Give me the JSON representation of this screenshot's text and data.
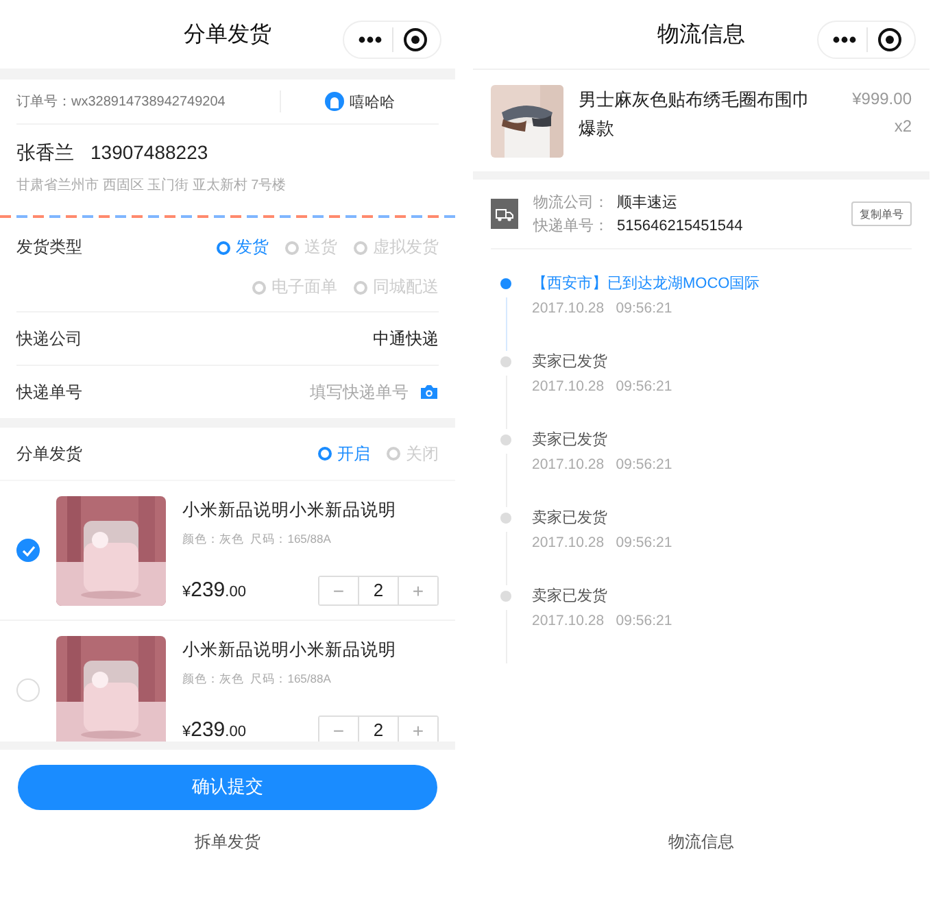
{
  "left": {
    "title": "分单发货",
    "order": {
      "label": "订单号：",
      "number": "wx328914738942749204",
      "user": "嘻哈哈"
    },
    "recipient": {
      "name": "张香兰",
      "phone": "13907488223",
      "address": "甘肃省兰州市 西固区 玉门街 亚太新村 7号楼"
    },
    "ship_type": {
      "label": "发货类型",
      "options": [
        {
          "label": "发货",
          "selected": true
        },
        {
          "label": "送货",
          "selected": false
        },
        {
          "label": "虚拟发货",
          "selected": false
        },
        {
          "label": "电子面单",
          "selected": false
        },
        {
          "label": "同城配送",
          "selected": false
        }
      ]
    },
    "courier": {
      "label": "快递公司",
      "value": "中通快递"
    },
    "tracking": {
      "label": "快递单号",
      "placeholder": "填写快递单号"
    },
    "split": {
      "label": "分单发货",
      "options": [
        {
          "label": "开启",
          "selected": true
        },
        {
          "label": "关闭",
          "selected": false
        }
      ]
    },
    "products": [
      {
        "checked": true,
        "title": "小米新品说明小米新品说明",
        "spec": "颜色：灰色  尺码：165/88A",
        "currency": "¥",
        "whole": "239",
        "cents": ".00",
        "minus": "−",
        "quantity": "2",
        "plus": "+"
      },
      {
        "checked": false,
        "title": "小米新品说明小米新品说明",
        "spec": "颜色：灰色  尺码：165/88A",
        "currency": "¥",
        "whole": "239",
        "cents": ".00",
        "minus": "−",
        "quantity": "2",
        "plus": "+"
      }
    ],
    "submit": "确认提交",
    "caption": "拆单发货"
  },
  "right": {
    "title": "物流信息",
    "product": {
      "title": "男士麻灰色贴布绣毛圈布围巾爆款",
      "price": "¥999.00",
      "quantity": "x2"
    },
    "shipping": {
      "company_label": "物流公司：",
      "company": "顺丰速运",
      "number_label": "快递单号：",
      "number": "515646215451544",
      "copy": "复制单号"
    },
    "timeline": [
      {
        "active": true,
        "title": "【西安市】已到达龙湖MOCO国际",
        "time": "2017.10.28   09:56:21"
      },
      {
        "active": false,
        "title": "卖家已发货",
        "time": "2017.10.28   09:56:21"
      },
      {
        "active": false,
        "title": "卖家已发货",
        "time": "2017.10.28   09:56:21"
      },
      {
        "active": false,
        "title": "卖家已发货",
        "time": "2017.10.28   09:56:21"
      },
      {
        "active": false,
        "title": "卖家已发货",
        "time": "2017.10.28   09:56:21"
      }
    ],
    "caption": "物流信息"
  }
}
